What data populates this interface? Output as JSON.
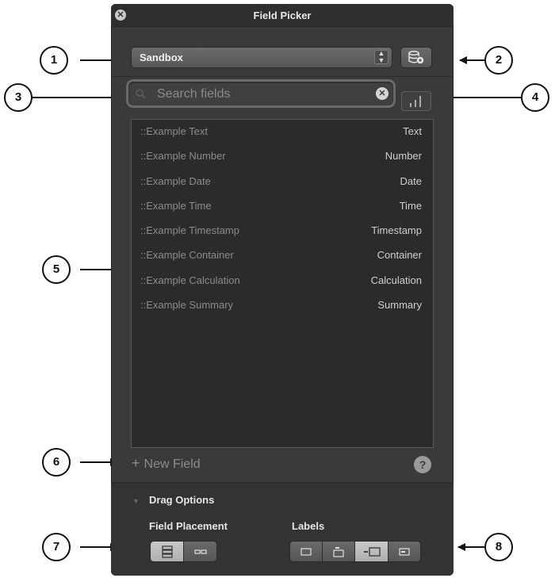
{
  "window": {
    "title": "Field Picker"
  },
  "table_selector": {
    "value": "Sandbox"
  },
  "search": {
    "placeholder": "Search fields",
    "value": ""
  },
  "fields": [
    {
      "name": "::Example Text",
      "type": "Text"
    },
    {
      "name": "::Example Number",
      "type": "Number"
    },
    {
      "name": "::Example Date",
      "type": "Date"
    },
    {
      "name": "::Example Time",
      "type": "Time"
    },
    {
      "name": "::Example Timestamp",
      "type": "Timestamp"
    },
    {
      "name": "::Example Container",
      "type": "Container"
    },
    {
      "name": "::Example Calculation",
      "type": "Calculation"
    },
    {
      "name": "::Example Summary",
      "type": "Summary"
    }
  ],
  "footer": {
    "new_field_plus": "+",
    "new_field_label": "New Field",
    "help_label": "?"
  },
  "drag_options": {
    "title": "Drag Options",
    "field_placement_title": "Field Placement",
    "labels_title": "Labels",
    "field_placement_selected": "vertical",
    "labels_selected": "left"
  },
  "callouts": [
    "1",
    "2",
    "3",
    "4",
    "5",
    "6",
    "7",
    "8"
  ],
  "colors": {
    "panel": "#3a3a3a",
    "list_bg": "#2b2b2b",
    "field_name": "#8b8b8b",
    "field_type": "#cfcfcf"
  }
}
